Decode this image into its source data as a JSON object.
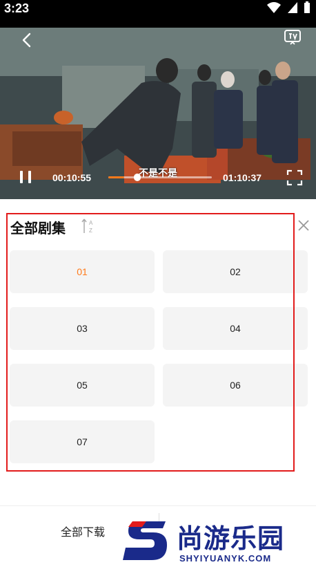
{
  "status_bar": {
    "time": "3:23"
  },
  "player": {
    "current_time": "00:10:55",
    "total_time": "01:10:37",
    "subtitle": "不是不是",
    "progress_fraction": 0.15,
    "accent_color": "#ff7a1a"
  },
  "episode_panel": {
    "title": "全部剧集",
    "sort_icon": "sort-az-icon",
    "close_icon": "close-icon",
    "selected_episode": "01",
    "episodes": [
      "01",
      "02",
      "03",
      "04",
      "05",
      "06",
      "07"
    ]
  },
  "bottom_bar": {
    "download_all_label": "全部下载"
  },
  "watermark": {
    "chinese_text": "尚游乐园",
    "english_text": "SHYIYUANYK.COM"
  },
  "annotation": {
    "highlight_color": "#e21b1b"
  }
}
